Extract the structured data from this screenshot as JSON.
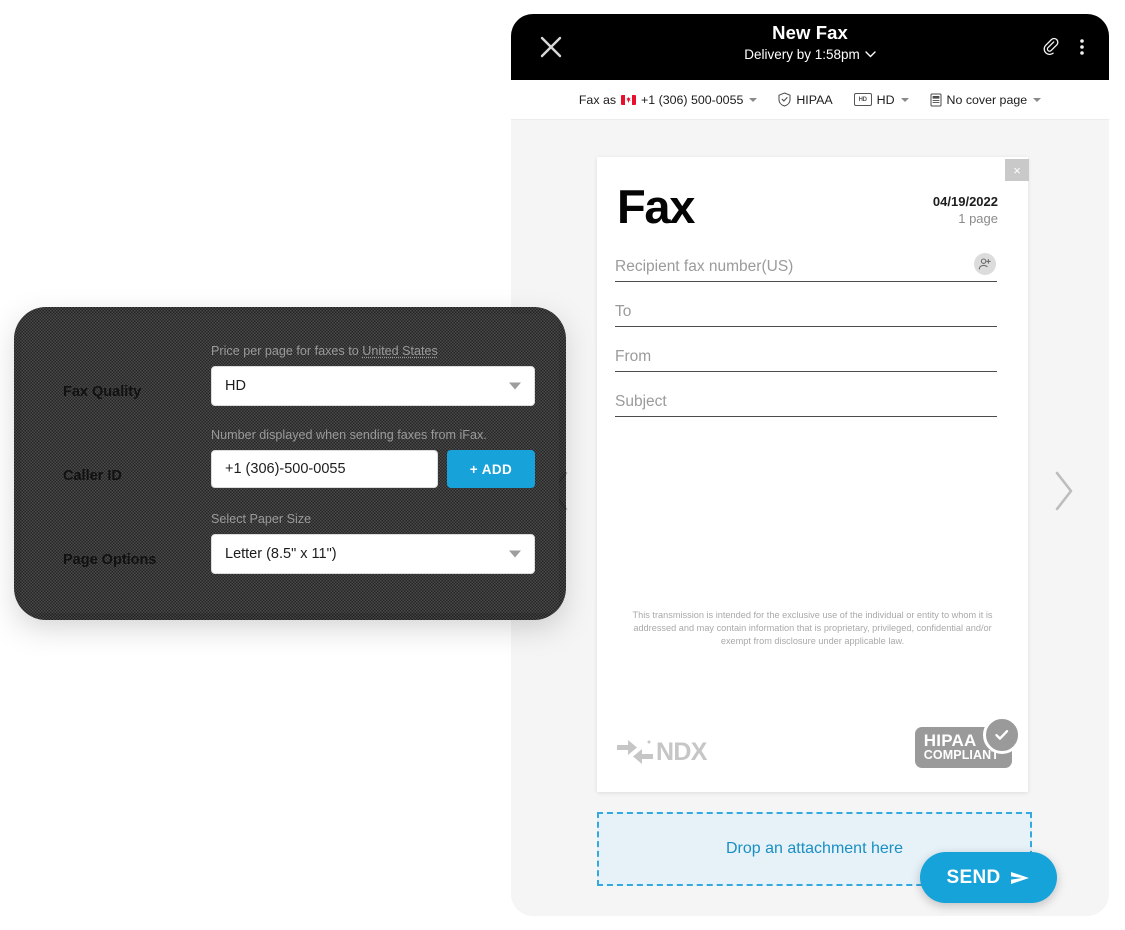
{
  "fax_window": {
    "titlebar": {
      "close_icon": "close-x-icon",
      "title": "New Fax",
      "delivery": "Delivery by 1:58pm",
      "delivery_caret": "chevron-down-icon",
      "attach_icon": "paperclip-icon",
      "more_icon": "more-vertical-icon"
    },
    "options_bar": [
      {
        "label": "Fax as",
        "value": "+1 (306) 500-0055",
        "icon": "canada-flag-icon",
        "has_caret": true
      },
      {
        "label": "HIPAA",
        "value": "",
        "icon": "shield-check-icon",
        "has_caret": false
      },
      {
        "label": "HD",
        "value": "",
        "icon": "hd-badge-icon",
        "has_caret": true
      },
      {
        "label": "No cover page",
        "value": "",
        "icon": "document-icon",
        "has_caret": true
      }
    ],
    "nav": {
      "prev_icon": "chevron-left-icon",
      "next_icon": "chevron-right-icon"
    },
    "page": {
      "close_icon": "close-x-icon",
      "close_glyph": "×",
      "heading": "Fax",
      "date": "04/19/2022",
      "page_count": "1 page",
      "fields": [
        {
          "name": "recipient",
          "placeholder": "Recipient fax number(US)",
          "value": "",
          "has_contact_button": true,
          "contact_icon": "add-contact-icon"
        },
        {
          "name": "to",
          "placeholder": "To",
          "value": "",
          "has_contact_button": false
        },
        {
          "name": "from",
          "placeholder": "From",
          "value": "",
          "has_contact_button": false
        },
        {
          "name": "subject",
          "placeholder": "Subject",
          "value": "",
          "has_contact_button": false
        }
      ],
      "disclaimer": "This transmission is intended for the exclusive use of the individual or entity to whom it is addressed and may contain information that is proprietary, privileged, confidential and/or exempt from disclosure under applicable law.",
      "footer": {
        "brand_logo_icon": "ndx-arrows-logo-icon",
        "brand_text": "NDX",
        "hipaa_line1": "HIPAA",
        "hipaa_line2": "COMPLIANT",
        "hipaa_check_icon": "check-circle-icon"
      }
    },
    "dropzone": {
      "label": "Drop an attachment here"
    },
    "send_button": {
      "label": "SEND",
      "icon": "send-arrow-icon"
    }
  },
  "settings_panel": {
    "rows": [
      {
        "label": "Fax Quality",
        "hint_prefix": "Price per page for faxes to ",
        "hint_link": "United States",
        "control": "select",
        "value": "HD",
        "caret_icon": "chevron-down-icon"
      },
      {
        "label": "Caller ID",
        "hint_prefix": "Number displayed when sending faxes from iFax.",
        "hint_link": "",
        "control": "input-with-button",
        "value": "+1 (306)-500-0055",
        "button_label": "+ ADD"
      },
      {
        "label": "Page Options",
        "hint_prefix": "Select Paper Size",
        "hint_link": "",
        "control": "select",
        "value": "Letter (8.5\" x 11\")",
        "caret_icon": "chevron-down-icon"
      }
    ]
  },
  "colors": {
    "accent_blue": "#16a3da",
    "dropzone_bg": "#e6f1f8",
    "dropzone_border": "#33a9dd",
    "titlebar_bg": "#000000",
    "panel_bg": "#f5f5f5"
  }
}
